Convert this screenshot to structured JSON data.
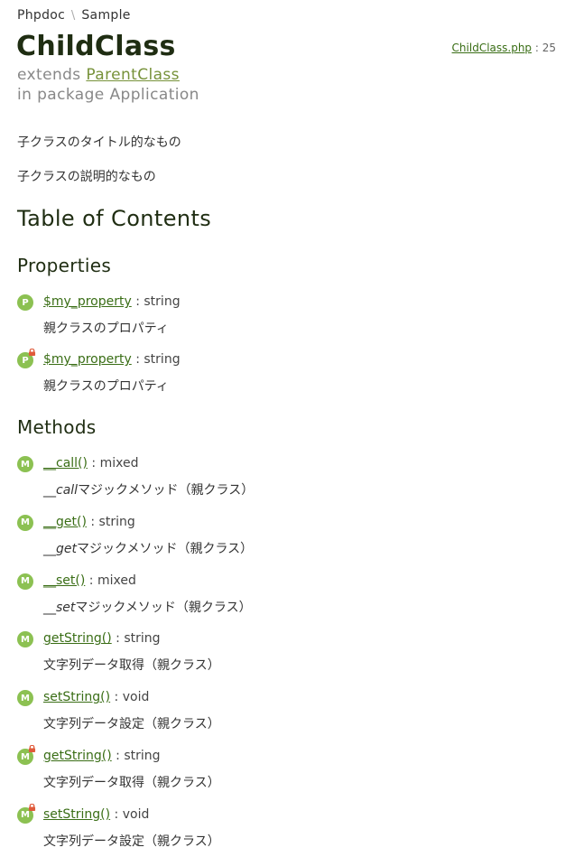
{
  "breadcrumb": {
    "root": "Phpdoc",
    "separator": "\\",
    "child": "Sample"
  },
  "class": {
    "name": "ChildClass",
    "file": "ChildClass.php",
    "line_separator": " : ",
    "line": "25",
    "extends_label": "extends",
    "parent": "ParentClass",
    "package_label": "in package Application"
  },
  "summary": "子クラスのタイトル的なもの",
  "description": "子クラスの説明的なもの",
  "toc": {
    "title": "Table of Contents",
    "properties_title": "Properties",
    "methods_title": "Methods"
  },
  "properties": [
    {
      "badge": "P",
      "name": "$my_property",
      "sep": " : ",
      "type": "string",
      "desc_em": "",
      "desc": "親クラスのプロパティ",
      "locked": false
    },
    {
      "badge": "P",
      "name": "$my_property",
      "sep": " : ",
      "type": "string",
      "desc_em": "",
      "desc": "親クラスのプロパティ",
      "locked": true
    }
  ],
  "methods": [
    {
      "badge": "M",
      "name": "__call()",
      "sep": " : ",
      "type": "mixed",
      "desc_em": "__call",
      "desc": "マジックメソッド（親クラス）",
      "locked": false
    },
    {
      "badge": "M",
      "name": "__get()",
      "sep": " : ",
      "type": "string",
      "desc_em": "__get",
      "desc": "マジックメソッド（親クラス）",
      "locked": false
    },
    {
      "badge": "M",
      "name": "__set()",
      "sep": " : ",
      "type": "mixed",
      "desc_em": "__set",
      "desc": "マジックメソッド（親クラス）",
      "locked": false
    },
    {
      "badge": "M",
      "name": "getString()",
      "sep": " : ",
      "type": "string",
      "desc_em": "",
      "desc": "文字列データ取得（親クラス）",
      "locked": false
    },
    {
      "badge": "M",
      "name": "setString()",
      "sep": " : ",
      "type": "void",
      "desc_em": "",
      "desc": "文字列データ設定（親クラス）",
      "locked": false
    },
    {
      "badge": "M",
      "name": "getString()",
      "sep": " : ",
      "type": "string",
      "desc_em": "",
      "desc": "文字列データ取得（親クラス）",
      "locked": true
    },
    {
      "badge": "M",
      "name": "setString()",
      "sep": " : ",
      "type": "void",
      "desc_em": "",
      "desc": "文字列データ設定（親クラス）",
      "locked": true
    }
  ],
  "colors": {
    "badge": "#8cc152",
    "lock": "#e05a3a",
    "link": "#3a6e16"
  },
  "icons": {
    "visibility_badge": "circle-letter-icon",
    "protected_marker": "lock-icon"
  }
}
